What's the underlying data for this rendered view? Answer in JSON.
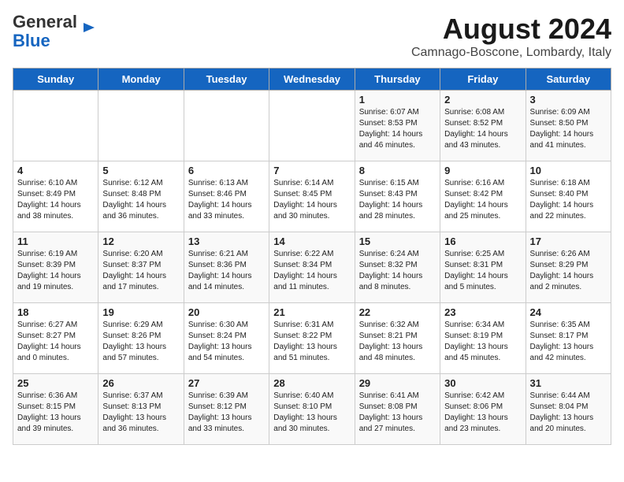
{
  "header": {
    "logo_general": "General",
    "logo_blue": "Blue",
    "title": "August 2024",
    "subtitle": "Camnago-Boscone, Lombardy, Italy"
  },
  "days_of_week": [
    "Sunday",
    "Monday",
    "Tuesday",
    "Wednesday",
    "Thursday",
    "Friday",
    "Saturday"
  ],
  "weeks": [
    [
      {
        "day": "",
        "info": ""
      },
      {
        "day": "",
        "info": ""
      },
      {
        "day": "",
        "info": ""
      },
      {
        "day": "",
        "info": ""
      },
      {
        "day": "1",
        "info": "Sunrise: 6:07 AM\nSunset: 8:53 PM\nDaylight: 14 hours and 46 minutes."
      },
      {
        "day": "2",
        "info": "Sunrise: 6:08 AM\nSunset: 8:52 PM\nDaylight: 14 hours and 43 minutes."
      },
      {
        "day": "3",
        "info": "Sunrise: 6:09 AM\nSunset: 8:50 PM\nDaylight: 14 hours and 41 minutes."
      }
    ],
    [
      {
        "day": "4",
        "info": "Sunrise: 6:10 AM\nSunset: 8:49 PM\nDaylight: 14 hours and 38 minutes."
      },
      {
        "day": "5",
        "info": "Sunrise: 6:12 AM\nSunset: 8:48 PM\nDaylight: 14 hours and 36 minutes."
      },
      {
        "day": "6",
        "info": "Sunrise: 6:13 AM\nSunset: 8:46 PM\nDaylight: 14 hours and 33 minutes."
      },
      {
        "day": "7",
        "info": "Sunrise: 6:14 AM\nSunset: 8:45 PM\nDaylight: 14 hours and 30 minutes."
      },
      {
        "day": "8",
        "info": "Sunrise: 6:15 AM\nSunset: 8:43 PM\nDaylight: 14 hours and 28 minutes."
      },
      {
        "day": "9",
        "info": "Sunrise: 6:16 AM\nSunset: 8:42 PM\nDaylight: 14 hours and 25 minutes."
      },
      {
        "day": "10",
        "info": "Sunrise: 6:18 AM\nSunset: 8:40 PM\nDaylight: 14 hours and 22 minutes."
      }
    ],
    [
      {
        "day": "11",
        "info": "Sunrise: 6:19 AM\nSunset: 8:39 PM\nDaylight: 14 hours and 19 minutes."
      },
      {
        "day": "12",
        "info": "Sunrise: 6:20 AM\nSunset: 8:37 PM\nDaylight: 14 hours and 17 minutes."
      },
      {
        "day": "13",
        "info": "Sunrise: 6:21 AM\nSunset: 8:36 PM\nDaylight: 14 hours and 14 minutes."
      },
      {
        "day": "14",
        "info": "Sunrise: 6:22 AM\nSunset: 8:34 PM\nDaylight: 14 hours and 11 minutes."
      },
      {
        "day": "15",
        "info": "Sunrise: 6:24 AM\nSunset: 8:32 PM\nDaylight: 14 hours and 8 minutes."
      },
      {
        "day": "16",
        "info": "Sunrise: 6:25 AM\nSunset: 8:31 PM\nDaylight: 14 hours and 5 minutes."
      },
      {
        "day": "17",
        "info": "Sunrise: 6:26 AM\nSunset: 8:29 PM\nDaylight: 14 hours and 2 minutes."
      }
    ],
    [
      {
        "day": "18",
        "info": "Sunrise: 6:27 AM\nSunset: 8:27 PM\nDaylight: 14 hours and 0 minutes."
      },
      {
        "day": "19",
        "info": "Sunrise: 6:29 AM\nSunset: 8:26 PM\nDaylight: 13 hours and 57 minutes."
      },
      {
        "day": "20",
        "info": "Sunrise: 6:30 AM\nSunset: 8:24 PM\nDaylight: 13 hours and 54 minutes."
      },
      {
        "day": "21",
        "info": "Sunrise: 6:31 AM\nSunset: 8:22 PM\nDaylight: 13 hours and 51 minutes."
      },
      {
        "day": "22",
        "info": "Sunrise: 6:32 AM\nSunset: 8:21 PM\nDaylight: 13 hours and 48 minutes."
      },
      {
        "day": "23",
        "info": "Sunrise: 6:34 AM\nSunset: 8:19 PM\nDaylight: 13 hours and 45 minutes."
      },
      {
        "day": "24",
        "info": "Sunrise: 6:35 AM\nSunset: 8:17 PM\nDaylight: 13 hours and 42 minutes."
      }
    ],
    [
      {
        "day": "25",
        "info": "Sunrise: 6:36 AM\nSunset: 8:15 PM\nDaylight: 13 hours and 39 minutes."
      },
      {
        "day": "26",
        "info": "Sunrise: 6:37 AM\nSunset: 8:13 PM\nDaylight: 13 hours and 36 minutes."
      },
      {
        "day": "27",
        "info": "Sunrise: 6:39 AM\nSunset: 8:12 PM\nDaylight: 13 hours and 33 minutes."
      },
      {
        "day": "28",
        "info": "Sunrise: 6:40 AM\nSunset: 8:10 PM\nDaylight: 13 hours and 30 minutes."
      },
      {
        "day": "29",
        "info": "Sunrise: 6:41 AM\nSunset: 8:08 PM\nDaylight: 13 hours and 27 minutes."
      },
      {
        "day": "30",
        "info": "Sunrise: 6:42 AM\nSunset: 8:06 PM\nDaylight: 13 hours and 23 minutes."
      },
      {
        "day": "31",
        "info": "Sunrise: 6:44 AM\nSunset: 8:04 PM\nDaylight: 13 hours and 20 minutes."
      }
    ]
  ]
}
